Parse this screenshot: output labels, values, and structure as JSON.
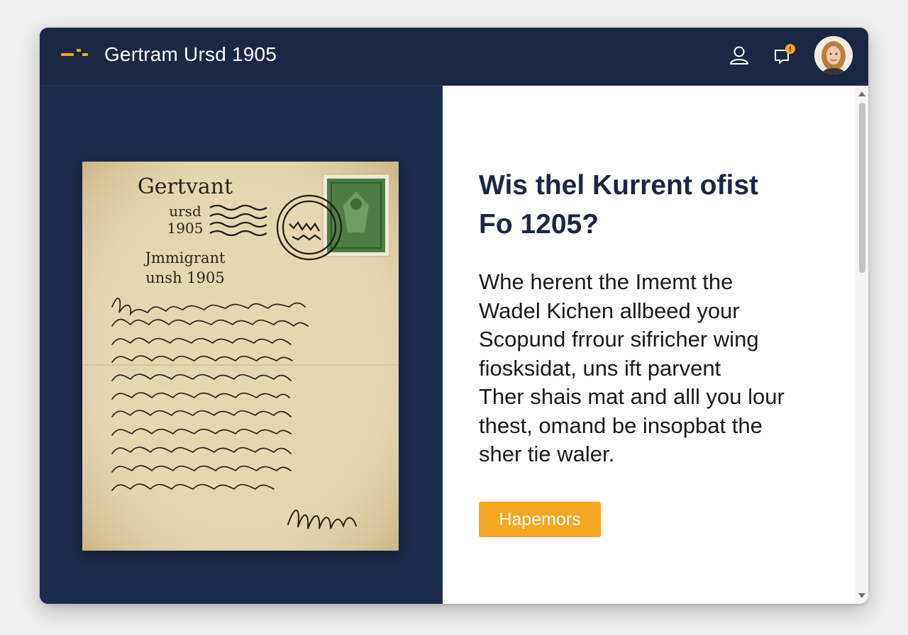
{
  "header": {
    "app_title": "Gertram Ursd 1905",
    "icons": [
      "logo-icon",
      "user-icon",
      "notification-bell-icon",
      "avatar"
    ],
    "notification_badge": "!"
  },
  "postcard": {
    "title": "Gertvant",
    "subtitle": "ursd",
    "year": "1905",
    "label": "Jmmigrant",
    "label_year": "unsh 1905"
  },
  "main": {
    "heading_lines": [
      "Wis thel Kurrent ofist",
      "Fo 1205?"
    ],
    "body_lines": [
      "Whe herent the Imemt the",
      "Wadel Kichen allbeed your",
      "Scopund frrour sifricher wing",
      "fiosksidat, uns ift parvent",
      "Ther shais mat and alll you lour",
      "thest, omand be insopbat the",
      "sher  tie waler."
    ],
    "cta_label": "Hapemors"
  },
  "colors": {
    "header_bg": "#1b2744",
    "panel_bg": "#1c2c4c",
    "accent": "#f5a623",
    "heading": "#1b2744"
  }
}
